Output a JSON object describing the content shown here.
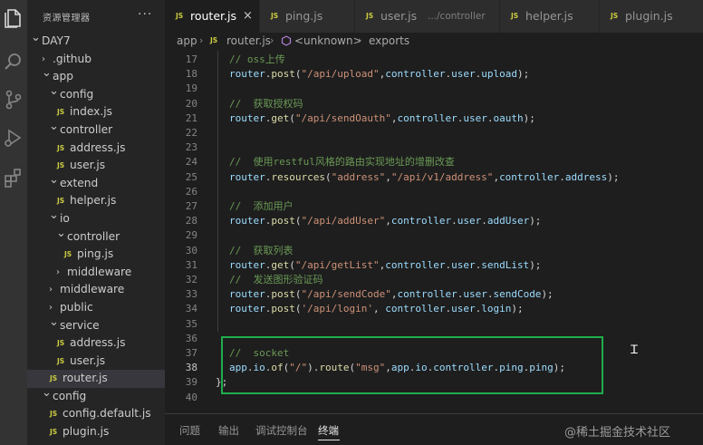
{
  "sidebar": {
    "title": "资源管理器",
    "more": "···",
    "tree": [
      {
        "label": "DAY7",
        "kind": "folder-open",
        "level": 0
      },
      {
        "label": ".github",
        "kind": "folder",
        "level": 1
      },
      {
        "label": "app",
        "kind": "folder-open",
        "level": 1
      },
      {
        "label": "config",
        "kind": "folder-open",
        "level": 2
      },
      {
        "label": "index.js",
        "kind": "file",
        "level": 3
      },
      {
        "label": "controller",
        "kind": "folder-open",
        "level": 2
      },
      {
        "label": "address.js",
        "kind": "file",
        "level": 3
      },
      {
        "label": "user.js",
        "kind": "file",
        "level": 3
      },
      {
        "label": "extend",
        "kind": "folder-open",
        "level": 2
      },
      {
        "label": "helper.js",
        "kind": "file",
        "level": 3
      },
      {
        "label": "io",
        "kind": "folder-open",
        "level": 2
      },
      {
        "label": "controller",
        "kind": "folder-open",
        "level": 3
      },
      {
        "label": "ping.js",
        "kind": "file",
        "level": 4
      },
      {
        "label": "middleware",
        "kind": "folder",
        "level": 3
      },
      {
        "label": "middleware",
        "kind": "folder",
        "level": 2
      },
      {
        "label": "public",
        "kind": "folder",
        "level": 2
      },
      {
        "label": "service",
        "kind": "folder-open",
        "level": 2
      },
      {
        "label": "address.js",
        "kind": "file",
        "level": 3
      },
      {
        "label": "user.js",
        "kind": "file",
        "level": 3
      },
      {
        "label": "router.js",
        "kind": "file",
        "level": 2,
        "selected": true
      },
      {
        "label": "config",
        "kind": "folder-open",
        "level": 1
      },
      {
        "label": "config.default.js",
        "kind": "file",
        "level": 2
      },
      {
        "label": "plugin.js",
        "kind": "file",
        "level": 2
      }
    ],
    "js_badge": "JS"
  },
  "tabs": [
    {
      "label": "router.js",
      "active": true
    },
    {
      "label": "ping.js"
    },
    {
      "label": "user.js",
      "description": ".../controller"
    },
    {
      "label": "helper.js"
    },
    {
      "label": "plugin.js"
    }
  ],
  "tab_close": "×",
  "breadcrumb": {
    "items": [
      "app",
      "router.js",
      "<unknown>",
      "exports"
    ]
  },
  "editor": {
    "current_line": "38",
    "lines": [
      {
        "n": "17",
        "tokens": [
          [
            "c-comment",
            "// oss上传"
          ]
        ]
      },
      {
        "n": "18",
        "tokens": [
          [
            "c-var",
            "router"
          ],
          [
            "c-punc",
            "."
          ],
          [
            "c-fn",
            "post"
          ],
          [
            "c-punc",
            "("
          ],
          [
            "c-str",
            "\"/api/upload\""
          ],
          [
            "c-punc",
            ","
          ],
          [
            "c-var",
            "controller"
          ],
          [
            "c-punc",
            "."
          ],
          [
            "c-var",
            "user"
          ],
          [
            "c-punc",
            "."
          ],
          [
            "c-var",
            "upload"
          ],
          [
            "c-punc",
            ");"
          ]
        ]
      },
      {
        "n": "19",
        "tokens": []
      },
      {
        "n": "20",
        "tokens": [
          [
            "c-comment",
            "//  获取授权码"
          ]
        ]
      },
      {
        "n": "21",
        "tokens": [
          [
            "c-var",
            "router"
          ],
          [
            "c-punc",
            "."
          ],
          [
            "c-fn",
            "get"
          ],
          [
            "c-punc",
            "("
          ],
          [
            "c-str",
            "\"/api/sendOauth\""
          ],
          [
            "c-punc",
            ","
          ],
          [
            "c-var",
            "controller"
          ],
          [
            "c-punc",
            "."
          ],
          [
            "c-var",
            "user"
          ],
          [
            "c-punc",
            "."
          ],
          [
            "c-var",
            "oauth"
          ],
          [
            "c-punc",
            ");"
          ]
        ]
      },
      {
        "n": "22",
        "tokens": []
      },
      {
        "n": "23",
        "tokens": []
      },
      {
        "n": "24",
        "tokens": [
          [
            "c-comment",
            "//  使用restful风格的路由实现地址的增删改查"
          ]
        ]
      },
      {
        "n": "25",
        "tokens": [
          [
            "c-var",
            "router"
          ],
          [
            "c-punc",
            "."
          ],
          [
            "c-fn",
            "resources"
          ],
          [
            "c-punc",
            "("
          ],
          [
            "c-str",
            "\"address\""
          ],
          [
            "c-punc",
            ","
          ],
          [
            "c-str",
            "\"/api/v1/address\""
          ],
          [
            "c-punc",
            ","
          ],
          [
            "c-var",
            "controller"
          ],
          [
            "c-punc",
            "."
          ],
          [
            "c-var",
            "address"
          ],
          [
            "c-punc",
            ");"
          ]
        ]
      },
      {
        "n": "26",
        "tokens": []
      },
      {
        "n": "27",
        "tokens": [
          [
            "c-comment",
            "//  添加用户"
          ]
        ]
      },
      {
        "n": "28",
        "tokens": [
          [
            "c-var",
            "router"
          ],
          [
            "c-punc",
            "."
          ],
          [
            "c-fn",
            "post"
          ],
          [
            "c-punc",
            "("
          ],
          [
            "c-str",
            "\"/api/addUser\""
          ],
          [
            "c-punc",
            ","
          ],
          [
            "c-var",
            "controller"
          ],
          [
            "c-punc",
            "."
          ],
          [
            "c-var",
            "user"
          ],
          [
            "c-punc",
            "."
          ],
          [
            "c-var",
            "addUser"
          ],
          [
            "c-punc",
            ");"
          ]
        ]
      },
      {
        "n": "29",
        "tokens": []
      },
      {
        "n": "30",
        "tokens": [
          [
            "c-comment",
            "//  获取列表"
          ]
        ]
      },
      {
        "n": "31",
        "tokens": [
          [
            "c-var",
            "router"
          ],
          [
            "c-punc",
            "."
          ],
          [
            "c-fn",
            "get"
          ],
          [
            "c-punc",
            "("
          ],
          [
            "c-str",
            "\"/api/getList\""
          ],
          [
            "c-punc",
            ","
          ],
          [
            "c-var",
            "controller"
          ],
          [
            "c-punc",
            "."
          ],
          [
            "c-var",
            "user"
          ],
          [
            "c-punc",
            "."
          ],
          [
            "c-var",
            "sendList"
          ],
          [
            "c-punc",
            ");"
          ]
        ]
      },
      {
        "n": "32",
        "tokens": [
          [
            "c-comment",
            "//  发送图形验证码"
          ]
        ]
      },
      {
        "n": "33",
        "tokens": [
          [
            "c-var",
            "router"
          ],
          [
            "c-punc",
            "."
          ],
          [
            "c-fn",
            "post"
          ],
          [
            "c-punc",
            "("
          ],
          [
            "c-str",
            "\"/api/sendCode\""
          ],
          [
            "c-punc",
            ","
          ],
          [
            "c-var",
            "controller"
          ],
          [
            "c-punc",
            "."
          ],
          [
            "c-var",
            "user"
          ],
          [
            "c-punc",
            "."
          ],
          [
            "c-var",
            "sendCode"
          ],
          [
            "c-punc",
            ");"
          ]
        ]
      },
      {
        "n": "34",
        "tokens": [
          [
            "c-var",
            "router"
          ],
          [
            "c-punc",
            "."
          ],
          [
            "c-fn",
            "post"
          ],
          [
            "c-punc",
            "("
          ],
          [
            "c-str",
            "'/api/login'"
          ],
          [
            "c-punc",
            ", "
          ],
          [
            "c-var",
            "controller"
          ],
          [
            "c-punc",
            "."
          ],
          [
            "c-var",
            "user"
          ],
          [
            "c-punc",
            "."
          ],
          [
            "c-var",
            "login"
          ],
          [
            "c-punc",
            ");"
          ]
        ]
      },
      {
        "n": "35",
        "tokens": []
      },
      {
        "n": "36",
        "tokens": []
      },
      {
        "n": "37",
        "tokens": [
          [
            "c-comment",
            "//  socket"
          ]
        ]
      },
      {
        "n": "38",
        "tokens": [
          [
            "c-var",
            "app"
          ],
          [
            "c-punc",
            "."
          ],
          [
            "c-var",
            "io"
          ],
          [
            "c-punc",
            "."
          ],
          [
            "c-fn",
            "of"
          ],
          [
            "c-punc",
            "("
          ],
          [
            "c-str",
            "\"/\""
          ],
          [
            "c-punc",
            ")."
          ],
          [
            "c-fn",
            "route"
          ],
          [
            "c-punc",
            "("
          ],
          [
            "c-str",
            "\"msg\""
          ],
          [
            "c-punc",
            ","
          ],
          [
            "c-var",
            "app"
          ],
          [
            "c-punc",
            "."
          ],
          [
            "c-var",
            "io"
          ],
          [
            "c-punc",
            "."
          ],
          [
            "c-var",
            "controller"
          ],
          [
            "c-punc",
            "."
          ],
          [
            "c-var",
            "ping"
          ],
          [
            "c-punc",
            "."
          ],
          [
            "c-var",
            "ping"
          ],
          [
            "c-punc",
            ");"
          ]
        ]
      },
      {
        "n": "39",
        "tokens": [
          [
            "c-punc",
            "};"
          ]
        ]
      },
      {
        "n": "40",
        "tokens": []
      }
    ]
  },
  "panel": {
    "tabs": [
      "问题",
      "输出",
      "调试控制台",
      "终端"
    ],
    "active_tab": "终端"
  },
  "watermark": "@稀土掘金技术社区",
  "colors": {
    "highlight_box": "#1fad4c",
    "js_badge": "#cbcb41",
    "folder_icon": "#c5c5c5"
  },
  "icons": [
    "files-icon",
    "search-icon",
    "source-control-icon",
    "run-debug-icon",
    "extensions-icon",
    "symbol-icon",
    "text-cursor-icon"
  ]
}
